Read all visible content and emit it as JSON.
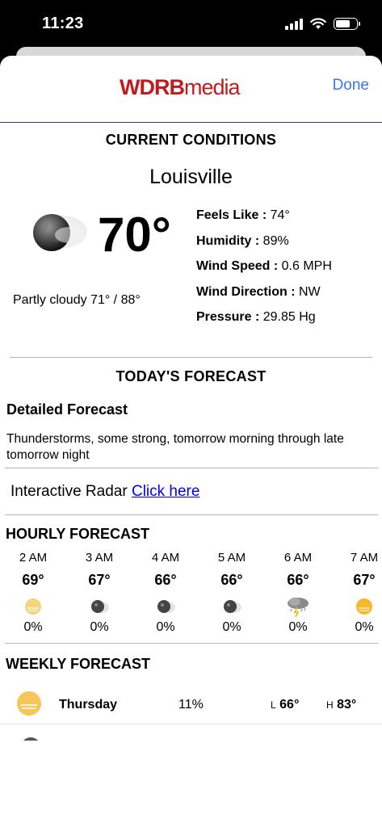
{
  "status_bar": {
    "time": "11:23"
  },
  "header": {
    "logo_brand": "WDRB",
    "logo_media": "media",
    "done_label": "Done"
  },
  "current": {
    "title": "CURRENT CONDITIONS",
    "city": "Louisville",
    "temp": "70°",
    "summary": "Partly cloudy 71° / 88°",
    "icon": "partly-cloudy-night-icon",
    "details": [
      {
        "label": "Feels Like :",
        "value": "74°"
      },
      {
        "label": "Humidity :",
        "value": "89%"
      },
      {
        "label": "Wind Speed :",
        "value": "0.6 MPH"
      },
      {
        "label": "Wind Direction :",
        "value": "NW"
      },
      {
        "label": "Pressure :",
        "value": "29.85 Hg"
      }
    ]
  },
  "today": {
    "title": "TODAY'S FORECAST",
    "detailed_title": "Detailed Forecast",
    "detailed_text": "Thunderstorms, some strong, tomorrow morning through late tomorrow night"
  },
  "radar": {
    "label": "Interactive Radar",
    "link": "Click here"
  },
  "hourly": {
    "title": "HOURLY FORECAST",
    "items": [
      {
        "time": "2 AM",
        "temp": "69°",
        "precip": "0%",
        "icon": "moon-haze-icon"
      },
      {
        "time": "3 AM",
        "temp": "67°",
        "precip": "0%",
        "icon": "moon-cloud-icon"
      },
      {
        "time": "4 AM",
        "temp": "66°",
        "precip": "0%",
        "icon": "moon-cloud-icon"
      },
      {
        "time": "5 AM",
        "temp": "66°",
        "precip": "0%",
        "icon": "moon-cloud-icon"
      },
      {
        "time": "6 AM",
        "temp": "66°",
        "precip": "0%",
        "icon": "thunderstorm-icon"
      },
      {
        "time": "7 AM",
        "temp": "67°",
        "precip": "0%",
        "icon": "sun-haze-icon"
      }
    ]
  },
  "weekly": {
    "title": "WEEKLY FORECAST",
    "rows": [
      {
        "day": "Thursday",
        "precip": "11%",
        "low_label": "L",
        "low": "66°",
        "high_label": "H",
        "high": "83°",
        "icon": "sun-haze-icon"
      }
    ]
  }
}
